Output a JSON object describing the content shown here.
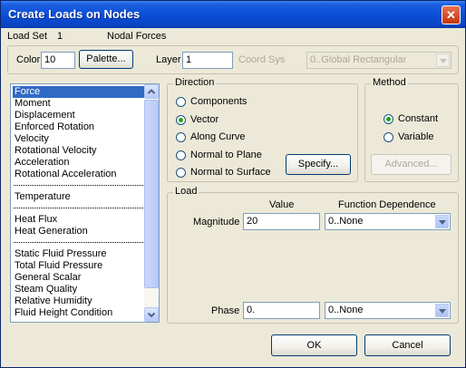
{
  "window": {
    "title": "Create Loads on Nodes",
    "close_label": "✕"
  },
  "header": {
    "load_set_label": "Load Set",
    "load_set_value": "1",
    "load_set_name": "Nodal Forces"
  },
  "toolbar": {
    "color_label": "Color",
    "color_value": "10",
    "palette_label": "Palette...",
    "layer_label": "Layer",
    "layer_value": "1",
    "coord_sys_label": "Coord Sys",
    "coord_sys_value": "0..Global Rectangular"
  },
  "load_types": {
    "groups": [
      [
        "Force",
        "Moment",
        "Displacement",
        "Enforced Rotation",
        "Velocity",
        "Rotational Velocity",
        "Acceleration",
        "Rotational Acceleration"
      ],
      [
        "Temperature"
      ],
      [
        "Heat Flux",
        "Heat Generation"
      ],
      [
        "Static Fluid Pressure",
        "Total Fluid Pressure",
        "General Scalar",
        "Steam Quality",
        "Relative Humidity",
        "Fluid Height Condition"
      ]
    ],
    "selected": "Force"
  },
  "direction": {
    "title": "Direction",
    "options": [
      "Components",
      "Vector",
      "Along Curve",
      "Normal to Plane",
      "Normal to Surface"
    ],
    "selected": "Vector",
    "specify_label": "Specify..."
  },
  "method": {
    "title": "Method",
    "options": [
      "Constant",
      "Variable"
    ],
    "selected": "Constant",
    "advanced_label": "Advanced..."
  },
  "load": {
    "title": "Load",
    "value_header": "Value",
    "function_header": "Function Dependence",
    "magnitude_label": "Magnitude",
    "magnitude_value": "20",
    "magnitude_function": "0..None",
    "phase_label": "Phase",
    "phase_value": "0.",
    "phase_function": "0..None"
  },
  "footer": {
    "ok_label": "OK",
    "cancel_label": "Cancel"
  },
  "colors": {
    "title_bar": "#0a4fd6",
    "selection": "#316ac5",
    "dialog_bg": "#ece9d8"
  }
}
